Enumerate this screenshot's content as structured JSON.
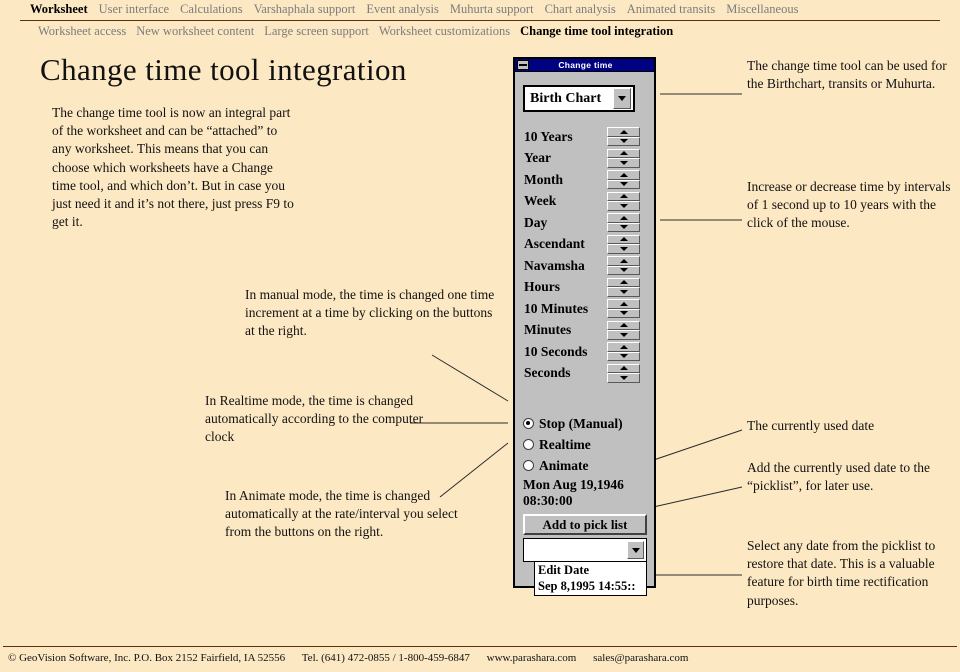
{
  "nav_primary": [
    {
      "label": "Worksheet",
      "active": true
    },
    {
      "label": "User interface",
      "active": false
    },
    {
      "label": "Calculations",
      "active": false
    },
    {
      "label": "Varshaphala support",
      "active": false
    },
    {
      "label": "Event analysis",
      "active": false
    },
    {
      "label": "Muhurta support",
      "active": false
    },
    {
      "label": "Chart analysis",
      "active": false
    },
    {
      "label": "Animated transits",
      "active": false
    },
    {
      "label": "Miscellaneous",
      "active": false
    }
  ],
  "nav_secondary": [
    {
      "label": "Worksheet access",
      "active": false
    },
    {
      "label": "New worksheet content",
      "active": false
    },
    {
      "label": "Large screen support",
      "active": false
    },
    {
      "label": "Worksheet customizations",
      "active": false
    },
    {
      "label": "Change time tool integration",
      "active": true
    }
  ],
  "page_title": "Change time tool integration",
  "paragraphs": {
    "intro": "The change time tool is now an integral part of the worksheet and can be “attached” to any worksheet. This means that you can choose which worksheets have a Change time tool, and which don’t.  But in case you just need it and it’s not there, just press F9 to get it.",
    "manual_mode": "In manual mode, the time is changed one time increment at a time by clicking on the buttons at the right.",
    "realtime_mode": "In Realtime mode, the time is changed automatically according to the computer clock",
    "animate_mode": "In Animate mode, the time is changed automatically at the rate/interval you select from the buttons on the right.",
    "right_tool_use": "The change time tool can be used for the Birthchart, transits or Muhurta.",
    "right_intervals": "Increase or decrease time by intervals of 1 second up to 10 years with the click of the mouse.",
    "right_current_date": "The currently used date",
    "right_add_picklist": "Add the currently used date to the “picklist”, for later use.",
    "right_select_picklist": "Select any date from the picklist to restore that date. This is a valuable feature for birth time rectification purposes."
  },
  "dialog": {
    "title": "Change time",
    "chart_select": {
      "value": "Birth Chart",
      "dropdown_icon": "chevron-down-icon"
    },
    "increments": [
      {
        "label": "10 Years"
      },
      {
        "label": "Year"
      },
      {
        "label": "Month"
      },
      {
        "label": "Week"
      },
      {
        "label": "Day"
      },
      {
        "label": "Ascendant"
      },
      {
        "label": "Navamsha"
      },
      {
        "label": "Hours"
      },
      {
        "label": "10 Minutes"
      },
      {
        "label": "Minutes"
      },
      {
        "label": "10 Seconds"
      },
      {
        "label": "Seconds"
      }
    ],
    "modes": [
      {
        "label": "Stop (Manual)",
        "selected": true
      },
      {
        "label": "Realtime",
        "selected": false
      },
      {
        "label": "Animate",
        "selected": false
      }
    ],
    "current_date": "Mon Aug 19,1946",
    "current_time": "08:30:00",
    "add_button": "Add to pick list",
    "picklist_value": "",
    "picklist_items": [
      "Edit Date",
      "Sep 8,1995  14:55::"
    ]
  },
  "footer": {
    "copyright": "© GeoVision Software, Inc. P.O. Box 2152 Fairfield, IA 52556",
    "phone": "Tel. (641) 472-0855 / 1-800-459-6847",
    "website": "www.parashara.com",
    "email": "sales@parashara.com"
  },
  "colors": {
    "page_bg": "#fce8c3",
    "titlebar": "#000082",
    "dialog_face": "#c0c0c0",
    "rule": "#5a3010",
    "nav_inactive": "#7c7c7c"
  }
}
